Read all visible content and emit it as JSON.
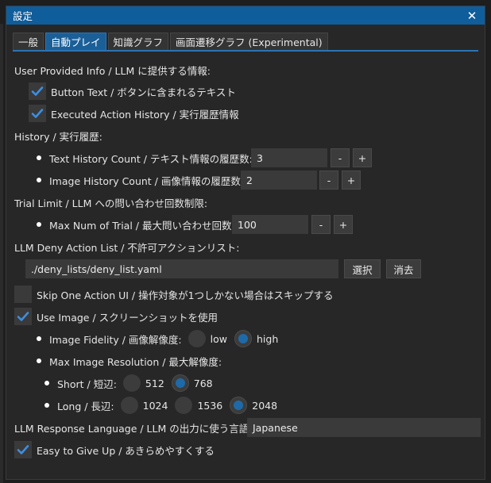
{
  "window": {
    "title": "設定",
    "close_glyph": "✕"
  },
  "tabs": [
    {
      "label": "一般",
      "active": false
    },
    {
      "label": "自動プレイ",
      "active": true
    },
    {
      "label": "知識グラフ",
      "active": false
    },
    {
      "label": "画面遷移グラフ (Experimental)",
      "active": false
    }
  ],
  "provided_info": {
    "heading": "User Provided Info / LLM に提供する情報:",
    "button_text": {
      "label": "Button Text / ボタンに含まれるテキスト",
      "checked": true
    },
    "executed_history": {
      "label": "Executed Action History / 実行履歴情報",
      "checked": true
    }
  },
  "history": {
    "heading": "History / 実行履歴:",
    "text_count": {
      "label": "Text History Count / テキスト情報の履歴数:",
      "value": "3",
      "minus": "-",
      "plus": "+"
    },
    "image_count": {
      "label": "Image History Count / 画像情報の履歴数:",
      "value": "2",
      "minus": "-",
      "plus": "+"
    }
  },
  "trial_limit": {
    "heading": "Trial Limit / LLM への問い合わせ回数制限:",
    "max_trial": {
      "label": "Max Num of Trial / 最大問い合わせ回数:",
      "value": "100",
      "minus": "-",
      "plus": "+"
    }
  },
  "deny_list": {
    "heading": "LLM Deny Action List / 不許可アクションリスト:",
    "path": "./deny_lists/deny_list.yaml",
    "select_label": "選択",
    "clear_label": "消去"
  },
  "skip_one_action": {
    "label": "Skip One Action UI / 操作対象が1つしかない場合はスキップする",
    "checked": false
  },
  "use_image": {
    "label": "Use Image / スクリーンショットを使用",
    "checked": true
  },
  "image_fidelity": {
    "label": "Image Fidelity / 画像解像度:",
    "options": [
      "low",
      "high"
    ],
    "selected": "high"
  },
  "max_resolution": {
    "label": "Max Image Resolution / 最大解像度:",
    "short": {
      "label": "Short / 短辺:",
      "options": [
        "512",
        "768"
      ],
      "selected": "768"
    },
    "long": {
      "label": "Long / 長辺:",
      "options": [
        "1024",
        "1536",
        "2048"
      ],
      "selected": "2048"
    }
  },
  "response_language": {
    "label": "LLM Response Language / LLM の出力に使う言語:",
    "value": "Japanese"
  },
  "easy_give_up": {
    "label": "Easy to Give Up / あきらめやすくする",
    "checked": true
  },
  "colors": {
    "accent": "#1b5f98",
    "check": "#3d8ee0",
    "titlebar": "#0f5d9b",
    "background": "#272727"
  }
}
